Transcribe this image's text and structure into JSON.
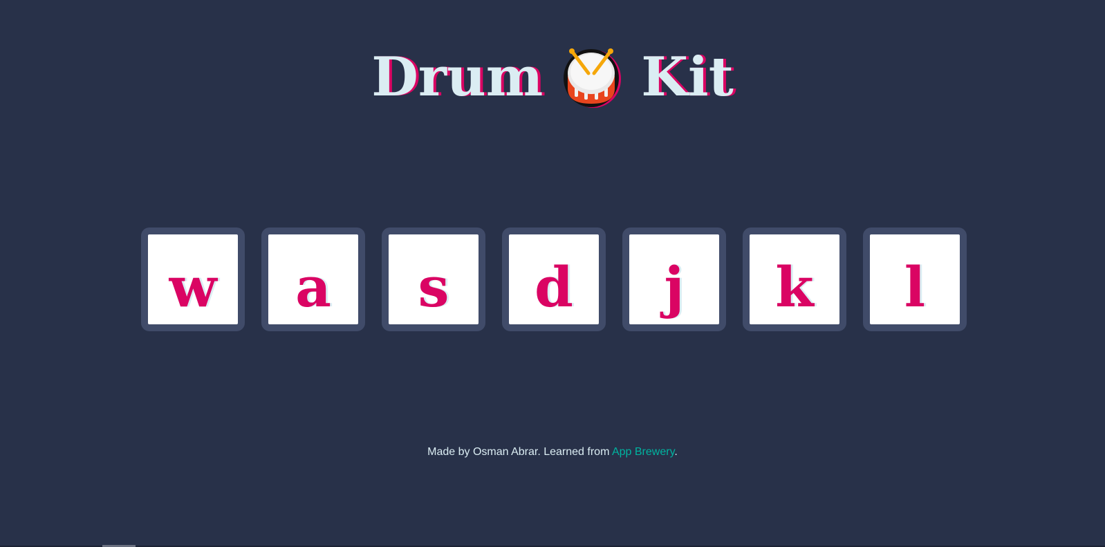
{
  "title": {
    "word1": "Drum",
    "icon": "drum-emoji",
    "word2": "Kit"
  },
  "keys": [
    {
      "label": "w"
    },
    {
      "label": "a"
    },
    {
      "label": "s"
    },
    {
      "label": "d"
    },
    {
      "label": "j"
    },
    {
      "label": "k"
    },
    {
      "label": "l"
    }
  ],
  "footer": {
    "prefix": "Made by Osman Abrar. Learned from ",
    "link_text": "App Brewery",
    "suffix": "."
  },
  "colors": {
    "background": "#283149",
    "title_text": "#DBEDF3",
    "accent": "#DA0463",
    "key_border": "#404B69",
    "link": "#00B4A0"
  }
}
